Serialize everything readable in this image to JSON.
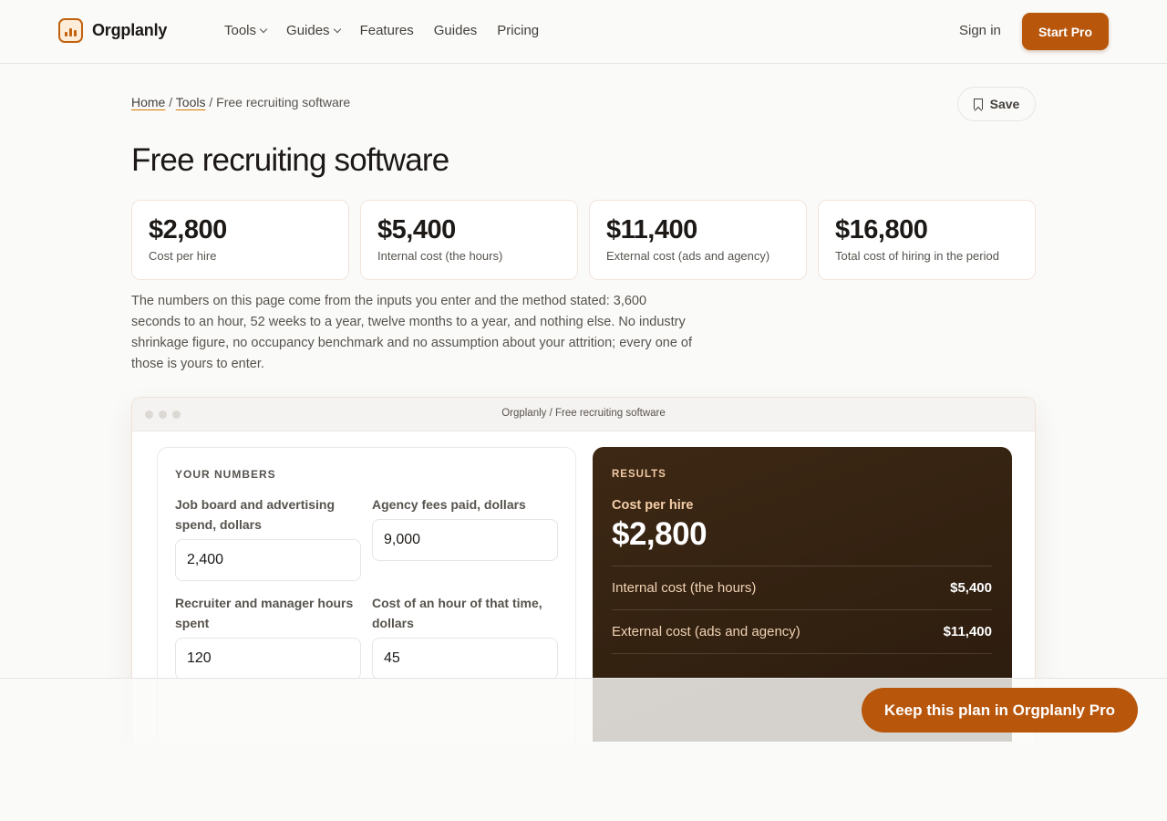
{
  "brand": {
    "name": "Orgplanly"
  },
  "nav": {
    "items": [
      {
        "label": "Tools",
        "dropdown": true
      },
      {
        "label": "Guides",
        "dropdown": true
      },
      {
        "label": "Features",
        "dropdown": false
      },
      {
        "label": "Guides",
        "dropdown": false
      },
      {
        "label": "Pricing",
        "dropdown": false
      }
    ],
    "sign_in": "Sign in",
    "start_pro": "Start Pro"
  },
  "breadcrumb": {
    "home": "Home",
    "tools": "Tools",
    "current": "Free recruiting software",
    "separator": "/"
  },
  "save_label": "Save",
  "page_title": "Free recruiting software",
  "stats": [
    {
      "value": "$2,800",
      "label": "Cost per hire"
    },
    {
      "value": "$5,400",
      "label": "Internal cost (the hours)"
    },
    {
      "value": "$11,400",
      "label": "External cost (ads and agency)"
    },
    {
      "value": "$16,800",
      "label": "Total cost of hiring in the period"
    }
  ],
  "intro": "The numbers on this page come from the inputs you enter and the method stated: 3,600 seconds to an hour, 52 weeks to a year, twelve months to a year, and nothing else. No industry shrinkage figure, no occupancy benchmark and no assumption about your attrition; every one of those is yours to enter.",
  "window": {
    "title": "Orgplanly / Free recruiting software",
    "inputs": {
      "heading": "YOUR NUMBERS",
      "fields": [
        {
          "label": "Job board and advertising spend, dollars",
          "value": "2,400"
        },
        {
          "label": "Agency fees paid, dollars",
          "value": "9,000"
        },
        {
          "label": "Recruiter and manager hours spent",
          "value": "120"
        },
        {
          "label": "Cost of an hour of that time, dollars",
          "value": "45"
        }
      ]
    },
    "results": {
      "heading": "RESULTS",
      "primary_label": "Cost per hire",
      "primary_value": "$2,800",
      "rows": [
        {
          "label": "Internal cost (the hours)",
          "value": "$5,400"
        },
        {
          "label": "External cost (ads and agency)",
          "value": "$11,400"
        }
      ]
    }
  },
  "sticky_cta": "Keep this plan in Orgplanly Pro",
  "colors": {
    "accent": "#b8560c",
    "results_bg": "#2f1f10"
  }
}
